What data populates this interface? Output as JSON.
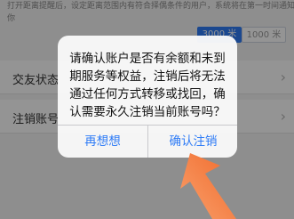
{
  "background": {
    "hint_text": "打开距离提醒后，设定距离范围内有符合择偶条件的用户，系统将在第一时间通知你",
    "distance_options": [
      "3000 米",
      "1000 米"
    ],
    "rows": [
      {
        "label": "交友状态"
      },
      {
        "label": "注销账号"
      }
    ]
  },
  "dialog": {
    "message": "请确认账户是否有余额和未到期服务等权益，注销后将无法通过任何方式转移或找回，确认需要永久注销当前账号吗？",
    "cancel_label": "再想想",
    "confirm_label": "确认注销"
  },
  "colors": {
    "accent": "#2f7cf6",
    "arrow": "#f26a2b"
  },
  "icons": {
    "row_chevron": "chevron-right-icon",
    "pointer": "arrow-pointer-icon"
  }
}
